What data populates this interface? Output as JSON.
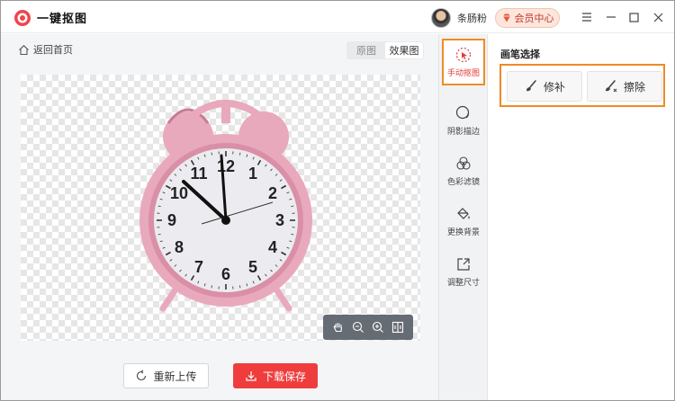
{
  "app": {
    "title": "一键抠图",
    "user": "条肠粉",
    "vip_label": "会员中心"
  },
  "window": {
    "menu_icon": "hamburger-icon",
    "minimize_icon": "minimize-icon",
    "maximize_icon": "maximize-icon",
    "close_icon": "close-icon"
  },
  "editor": {
    "back_label": "返回首页",
    "tabs": [
      {
        "label": "原图",
        "active": false
      },
      {
        "label": "效果图",
        "active": true
      }
    ],
    "clock_numbers": [
      "12",
      "1",
      "2",
      "3",
      "4",
      "5",
      "6",
      "7",
      "8",
      "9",
      "10",
      "11"
    ],
    "toolbar_icons": [
      "hand-icon",
      "zoom-out-icon",
      "zoom-in-icon",
      "compare-icon"
    ],
    "reupload_label": "重新上传",
    "download_label": "下载保存"
  },
  "sidenav": {
    "items": [
      {
        "label": "手动抠图",
        "icon": "cursor-icon",
        "active": true
      },
      {
        "label": "阴影描边",
        "icon": "shadow-icon",
        "active": false
      },
      {
        "label": "色彩滤镜",
        "icon": "color-filter-icon",
        "active": false
      },
      {
        "label": "更换背景",
        "icon": "paint-bucket-icon",
        "active": false
      },
      {
        "label": "调整尺寸",
        "icon": "resize-icon",
        "active": false
      }
    ]
  },
  "brush_panel": {
    "title": "画笔选择",
    "buttons": [
      {
        "label": "修补",
        "icon": "brush-repair-icon"
      },
      {
        "label": "擦除",
        "icon": "brush-erase-icon"
      }
    ]
  },
  "colors": {
    "accent": "#ef3d3d",
    "highlight": "#f08a24",
    "clock_pink": "#e9a9bd"
  }
}
